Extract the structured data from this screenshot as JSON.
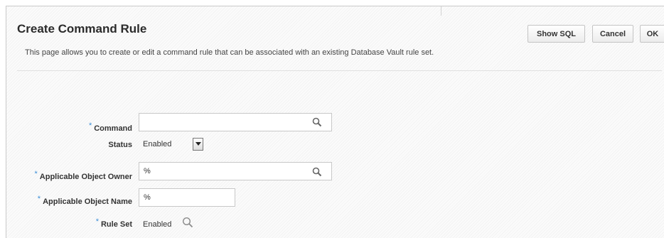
{
  "header": {
    "title": "Create Command Rule",
    "description": "This page allows you to create or edit a command rule that can be associated with an existing Database Vault rule set."
  },
  "actions": {
    "show_sql": "Show SQL",
    "cancel": "Cancel",
    "ok": "OK"
  },
  "form": {
    "required_marker": "*",
    "command": {
      "label": "Command",
      "value": "",
      "required": true
    },
    "status": {
      "label": "Status",
      "value": "Enabled"
    },
    "object_owner": {
      "label": "Applicable Object Owner",
      "value": "%",
      "required": true
    },
    "object_name": {
      "label": "Applicable Object Name",
      "value": "%",
      "required": true
    },
    "rule_set": {
      "label": "Rule Set",
      "value": "Enabled",
      "required": true
    }
  },
  "icons": {
    "search": "search-icon",
    "dropdown": "chevron-down-icon"
  },
  "colors": {
    "required_marker": "#3c8ed6",
    "title": "#2b2b2b"
  }
}
